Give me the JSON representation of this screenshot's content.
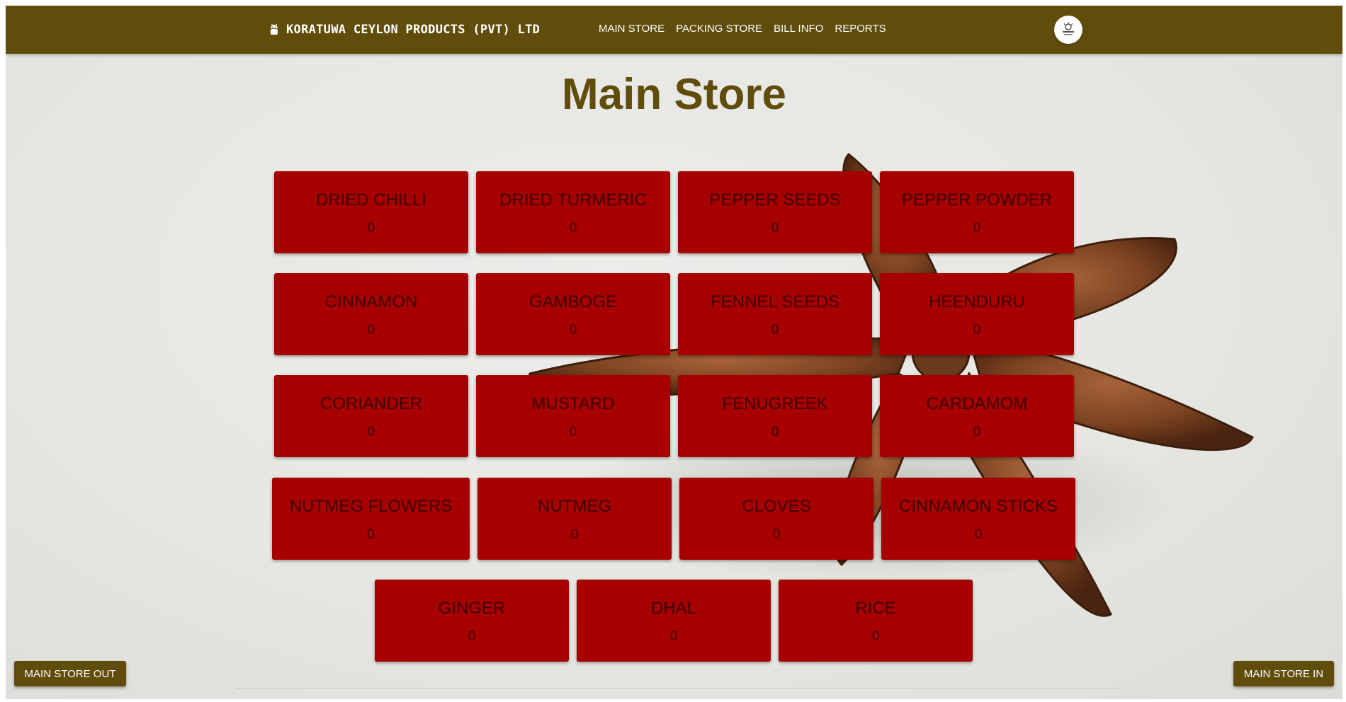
{
  "header": {
    "brand": "KORATUWA CEYLON PRODUCTS (PVT) LTD",
    "brand_icon": "android-icon",
    "nav": [
      "MAIN STORE",
      "PACKING STORE",
      "BILL INFO",
      "REPORTS"
    ],
    "avatar_icon": "company-logo"
  },
  "page": {
    "title": "Main Store"
  },
  "items": [
    {
      "name": "DRIED CHILLI",
      "count": "0"
    },
    {
      "name": "DRIED TURMERIC",
      "count": "0"
    },
    {
      "name": "PEPPER SEEDS",
      "count": "0"
    },
    {
      "name": "PEPPER POWDER",
      "count": "0"
    },
    {
      "name": "CINNAMON",
      "count": "0"
    },
    {
      "name": "GAMBOGE",
      "count": "0"
    },
    {
      "name": "FENNEL SEEDS",
      "count": "0"
    },
    {
      "name": "HEENDURU",
      "count": "0"
    },
    {
      "name": "CORIANDER",
      "count": "0"
    },
    {
      "name": "MUSTARD",
      "count": "0"
    },
    {
      "name": "FENUGREEK",
      "count": "0"
    },
    {
      "name": "CARDAMOM",
      "count": "0"
    },
    {
      "name": "NUTMEG FLOWERS",
      "count": "0"
    },
    {
      "name": "NUTMEG",
      "count": "0"
    },
    {
      "name": "CLOVES",
      "count": "0"
    },
    {
      "name": "CINNAMON STICKS",
      "count": "0"
    },
    {
      "name": "GINGER",
      "count": "0"
    },
    {
      "name": "DHAL",
      "count": "0"
    },
    {
      "name": "RICE",
      "count": "0"
    }
  ],
  "actions": {
    "out_label": "MAIN STORE OUT",
    "in_label": "MAIN STORE IN"
  },
  "colors": {
    "navbar": "#614d0b",
    "tile": "#a70000",
    "title": "#614d0b"
  }
}
